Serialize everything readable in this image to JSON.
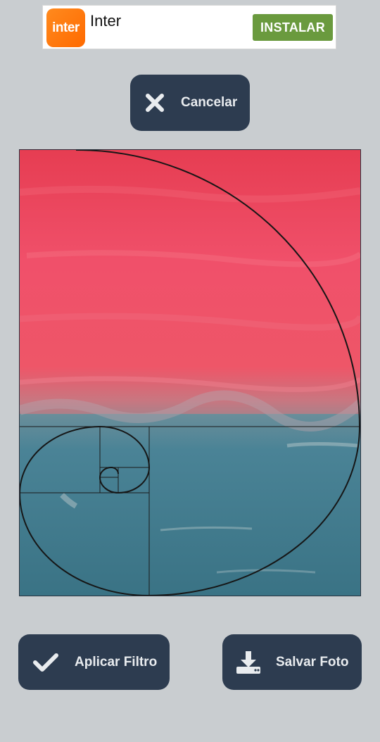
{
  "ad": {
    "logo_text": "inter",
    "title": "Inter",
    "install_label": "INSTALAR",
    "logo_color": "#ff7a0f",
    "install_color": "#6a9a3e"
  },
  "toolbar": {
    "cancel_label": "Cancelar",
    "cancel_icon": "close-icon"
  },
  "photo": {
    "overlay": "golden-spiral-grid",
    "sky_color": "#ec4a5f",
    "sea_color": "#3f7c90"
  },
  "actions": {
    "apply_filter_label": "Aplicar Filtro",
    "apply_filter_icon": "check-icon",
    "save_photo_label": "Salvar Foto",
    "save_photo_icon": "download-icon"
  },
  "colors": {
    "background": "#c9cdd0",
    "button_bg": "#2d3c50",
    "button_text": "#e9ecef"
  }
}
